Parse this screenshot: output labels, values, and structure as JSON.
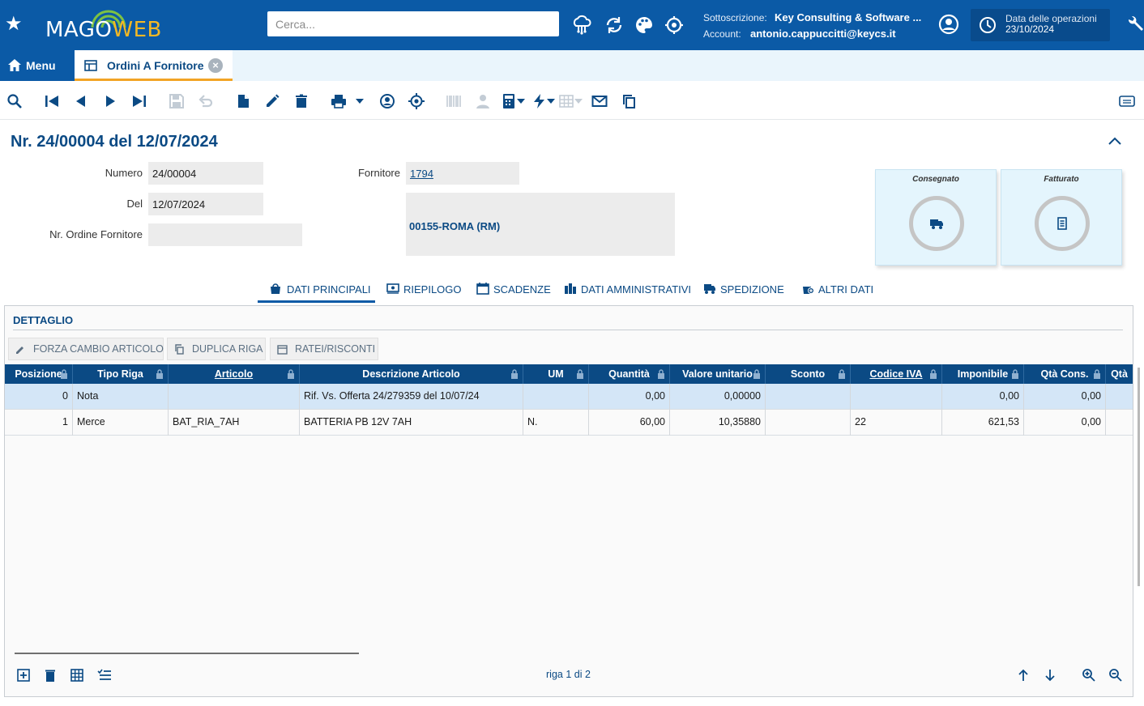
{
  "app": {
    "logo_main": "MAGO",
    "logo_accent": "WEB",
    "search_placeholder": "Cerca...",
    "subscription_label": "Sottoscrizione:",
    "subscription_value": "Key Consulting & Software ...",
    "account_label": "Account:",
    "account_value": "antonio.cappuccitti@keycs.it",
    "ops_date_label": "Data delle operazioni",
    "ops_date_value": "23/10/2024",
    "brand_color": "#0b5aa6",
    "accent_color": "#f2a425"
  },
  "tabs": {
    "menu_label": "Menu",
    "document_tab_label": "Ordini A Fornitore",
    "close_glyph": "×"
  },
  "document": {
    "title": "Nr. 24/00004 del 12/07/2024",
    "fields": {
      "numero_label": "Numero",
      "numero_value": "24/00004",
      "del_label": "Del",
      "del_value": "12/07/2024",
      "nr_ordine_fornitore_label": "Nr. Ordine Fornitore",
      "nr_ordine_fornitore_value": "",
      "fornitore_label": "Fornitore",
      "fornitore_value": "1794",
      "address_line": "00155-ROMA (RM)"
    },
    "status": {
      "consegnato_label": "Consegnato",
      "fatturato_label": "Fatturato"
    }
  },
  "section_tabs": [
    {
      "label": "DATI PRINCIPALI",
      "icon": "bag-icon",
      "active": true
    },
    {
      "label": "RIEPILOGO",
      "icon": "money-icon"
    },
    {
      "label": "SCADENZE",
      "icon": "calendar-icon"
    },
    {
      "label": "DATI AMMINISTRATIVI",
      "icon": "buildings-icon"
    },
    {
      "label": "SPEDIZIONE",
      "icon": "truck-icon"
    },
    {
      "label": "ALTRI DATI",
      "icon": "plus-icon"
    }
  ],
  "detail": {
    "title": "DETTAGLIO",
    "actions": {
      "forza_cambio": "FORZA CAMBIO ARTICOLO",
      "duplica_riga": "DUPLICA RIGA",
      "ratei_risconti": "RATEI/RISCONTI"
    },
    "columns": [
      "Posizione",
      "Tipo Riga",
      "Articolo",
      "Descrizione Articolo",
      "UM",
      "Quantità",
      "Valore unitario",
      "Sconto",
      "Codice IVA",
      "Imponibile",
      "Qtà Cons.",
      "Qtà"
    ],
    "rows": [
      {
        "posizione": "0",
        "tipo_riga": "Nota",
        "articolo": "",
        "descrizione": "Rif. Vs. Offerta 24/279359 del 10/07/24",
        "um": "",
        "quantita": "0,00",
        "valore_unitario": "0,00000",
        "sconto": "",
        "codice_iva": "",
        "imponibile": "0,00",
        "qta_cons": "0,00"
      },
      {
        "posizione": "1",
        "tipo_riga": "Merce",
        "articolo": "BAT_RIA_7AH",
        "descrizione": "BATTERIA PB 12V 7AH",
        "um": "N.",
        "quantita": "60,00",
        "valore_unitario": "10,35880",
        "sconto": "",
        "codice_iva": "22",
        "imponibile": "621,53",
        "qta_cons": "0,00"
      }
    ],
    "pager": "riga 1 di 2"
  }
}
